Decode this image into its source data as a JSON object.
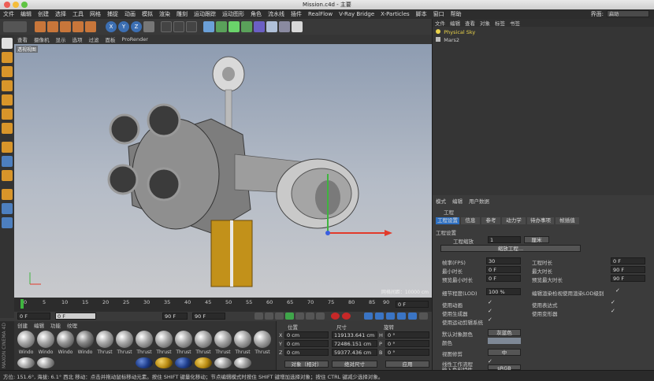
{
  "window": {
    "title": "Mission.c4d - 主要"
  },
  "menubar": {
    "items": [
      "文件",
      "编辑",
      "创建",
      "选择",
      "工具",
      "网格",
      "捕捉",
      "动画",
      "模拟",
      "渲染",
      "雕刻",
      "运动跟踪",
      "运动图形",
      "角色",
      "流水线",
      "插件",
      "RealFlow",
      "V-Ray Bridge",
      "X-Particles",
      "脚本",
      "窗口",
      "帮助"
    ],
    "layout_label": "界面:",
    "layout_value": "启动"
  },
  "viewport": {
    "menu": [
      "查看",
      "摄像机",
      "显示",
      "选项",
      "过滤",
      "面板",
      "ProRender"
    ],
    "label": "透视视图",
    "grid_label": "网格间距：10000 cm"
  },
  "timeline": {
    "ticks": [
      "0",
      "5",
      "10",
      "15",
      "20",
      "25",
      "30",
      "35",
      "40",
      "45",
      "50",
      "55",
      "60",
      "65",
      "70",
      "75",
      "80",
      "85",
      "90"
    ],
    "frame_display": "0 F"
  },
  "transport": {
    "start": "0 F",
    "current": "0 F",
    "end": "90 F",
    "end2": "90 F"
  },
  "materials": {
    "menu": [
      "创建",
      "编辑",
      "功能",
      "纹理"
    ],
    "labels": [
      "Windo",
      "Windo",
      "Windo",
      "Windo",
      "Thrust",
      "Thrust",
      "Thrust",
      "Thrust",
      "Thrust",
      "Thrust",
      "Thrust",
      "Thrust",
      "Thrust"
    ],
    "brand": "MAXON CINEMA 4D"
  },
  "coords": {
    "headers": [
      "位置",
      "尺寸",
      "旋转"
    ],
    "rows": [
      {
        "axis": "X",
        "pos": "0 cm",
        "size": "119133.641 cm",
        "rot_axis": "H",
        "rot": "0 °"
      },
      {
        "axis": "Y",
        "pos": "0 cm",
        "size": "72486.151 cm",
        "rot_axis": "P",
        "rot": "0 °"
      },
      {
        "axis": "Z",
        "pos": "0 cm",
        "size": "59377.436 cm",
        "rot_axis": "B",
        "rot": "0 °"
      }
    ],
    "mode_select": "对象（相对）",
    "size_select": "绝对尺寸",
    "apply": "应用"
  },
  "object_manager": {
    "menu": [
      "文件",
      "编辑",
      "查看",
      "对象",
      "标签",
      "书签"
    ],
    "objects": [
      {
        "name": "Physical Sky",
        "color": "#e9d24a"
      },
      {
        "name": "Mars2",
        "color": "#cccccc"
      }
    ]
  },
  "attributes": {
    "menu": [
      "模式",
      "编辑",
      "用户数据"
    ],
    "title": "工程",
    "tabs": [
      "工程设置",
      "信息",
      "参考",
      "动力学",
      "待办事项",
      "帧插值"
    ],
    "section": "工程设置",
    "scale_label": "工程缩放",
    "scale_value": "1",
    "scale_unit": "厘米",
    "scale_button": "缩放工程...",
    "left_fields": [
      {
        "label": "帧率(FPS)",
        "value": "30"
      },
      {
        "label": "最小时长",
        "value": "0 F"
      },
      {
        "label": "预览最小时长",
        "value": "0 F"
      },
      {
        "label": "细节程度(LOD)",
        "value": "100 %"
      }
    ],
    "right_fields": [
      {
        "label": "工程时长",
        "value": "0 F"
      },
      {
        "label": "最大时长",
        "value": "90 F"
      },
      {
        "label": "预览最大时长",
        "value": "90 F"
      },
      {
        "label": "编辑渲染检视使用渲染LOD级别",
        "value": ""
      }
    ],
    "checks_left": [
      "使用动画",
      "使用生成器",
      "使用运动剪辑系统"
    ],
    "checks_right": [
      "使用表达式",
      "使用变形器"
    ],
    "default_color_label": "默认对象颜色",
    "default_color_value": "灰蓝色",
    "color_label": "颜色",
    "view_clip_label": "视图修剪",
    "view_clip_value": "中",
    "linear_label": "线性工作流程",
    "input_color_label": "输入色彩特性",
    "input_color_value": "sRGB"
  },
  "statusbar": {
    "text": "方位: 151.6°, 海拔: 6.1° 西北    移动：点击并拖动鼠标移动元素。按住 SHIFT 键量化移动；节点编辑模式时按住 SHIFT 键增加选择对象；按住 CTRL 键减少选择对象。"
  }
}
